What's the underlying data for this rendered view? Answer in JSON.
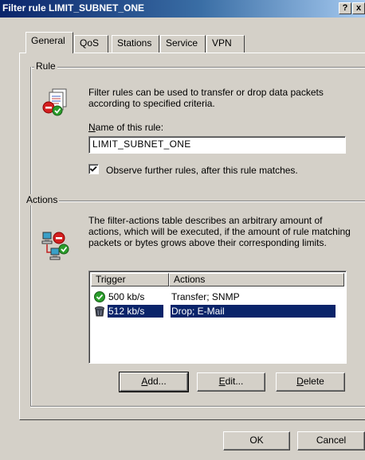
{
  "window": {
    "title": "Filter rule LIMIT_SUBNET_ONE",
    "help_button": "?",
    "close_button": "x"
  },
  "tabs": [
    {
      "label": "General",
      "active": true
    },
    {
      "label": "QoS",
      "active": false
    },
    {
      "label": "Stations",
      "active": false
    },
    {
      "label": "Service",
      "active": false
    },
    {
      "label": "VPN",
      "active": false
    }
  ],
  "rule_group": {
    "label": "Rule",
    "description": "Filter rules can be used to transfer or drop data packets according to specified criteria.",
    "name_label": "Name of this rule:",
    "name_value": "LIMIT_SUBNET_ONE",
    "observe_checkbox": {
      "label": "Observe further rules, after this rule matches.",
      "checked": true
    }
  },
  "actions_group": {
    "label": "Actions",
    "description": "The filter-actions table describes an arbitrary amount of actions, which will be executed, if the amount of rule matching packets or bytes grows above their corresponding limits.",
    "table": {
      "columns": [
        "Trigger",
        "Actions"
      ],
      "rows": [
        {
          "trigger": "500 kb/s",
          "actions": "Transfer; SNMP",
          "icon": "green-check-icon",
          "selected": false
        },
        {
          "trigger": "512 kb/s",
          "actions": "Drop; E-Mail",
          "icon": "trash-bin-icon",
          "selected": true
        }
      ]
    },
    "buttons": {
      "add": "Add...",
      "edit": "Edit...",
      "delete": "Delete"
    }
  },
  "footer": {
    "ok": "OK",
    "cancel": "Cancel"
  },
  "colors": {
    "title_bar": "#0a246a",
    "dialog_face": "#d4d0c8",
    "selection": "#0a246a"
  }
}
